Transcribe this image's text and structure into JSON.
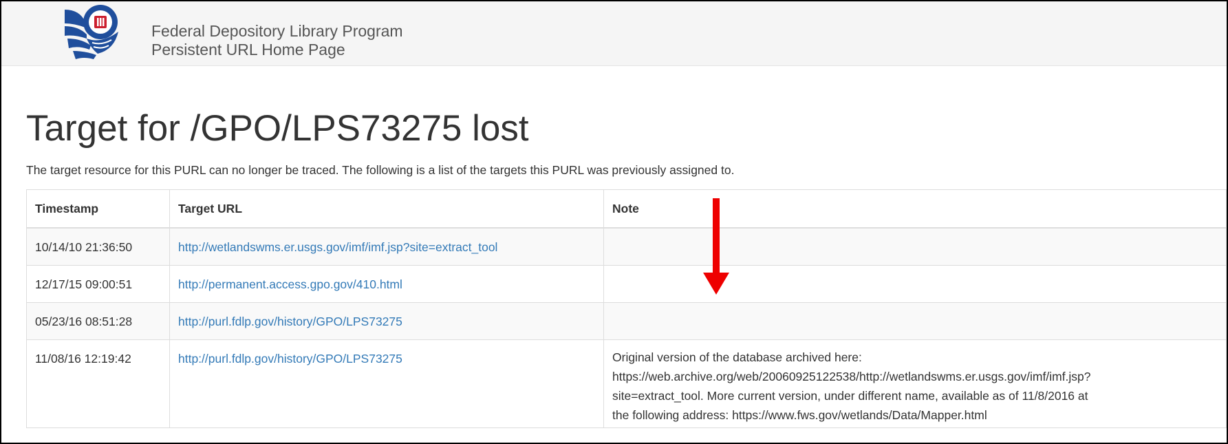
{
  "header": {
    "logo_name": "fdlp-eagle-logo",
    "brand_line1": "Federal Depository Library Program",
    "brand_line2": "Persistent URL Home Page"
  },
  "main": {
    "title": "Target for /GPO/LPS73275 lost",
    "intro": "The target resource for this PURL can no longer be traced. The following is a list of the targets this PURL was previously assigned to."
  },
  "table": {
    "headers": [
      "Timestamp",
      "Target URL",
      "Note"
    ],
    "rows": [
      {
        "timestamp": "10/14/10 21:36:50",
        "url": "http://wetlandswms.er.usgs.gov/imf/imf.jsp?site=extract_tool",
        "note": ""
      },
      {
        "timestamp": "12/17/15 09:00:51",
        "url": "http://permanent.access.gpo.gov/410.html",
        "note": ""
      },
      {
        "timestamp": "05/23/16 08:51:28",
        "url": "http://purl.fdlp.gov/history/GPO/LPS73275",
        "note": ""
      },
      {
        "timestamp": "11/08/16 12:19:42",
        "url": "http://purl.fdlp.gov/history/GPO/LPS73275",
        "note_lines": [
          "Original version of the database archived here:",
          "https://web.archive.org/web/20060925122538/http://wetlandswms.er.usgs.gov/imf/imf.jsp?",
          "site=extract_tool. More current version, under different name, available as of 11/8/2016 at",
          "the following address: https://www.fws.gov/wetlands/Data/Mapper.html"
        ]
      }
    ]
  },
  "colors": {
    "link": "#337ab7",
    "header_bg": "#f5f5f5",
    "stripe_bg": "#f9f9f9",
    "border": "#dddddd",
    "annotation_arrow": "#ee0000"
  },
  "annotation": {
    "icon": "down-arrow-icon"
  }
}
